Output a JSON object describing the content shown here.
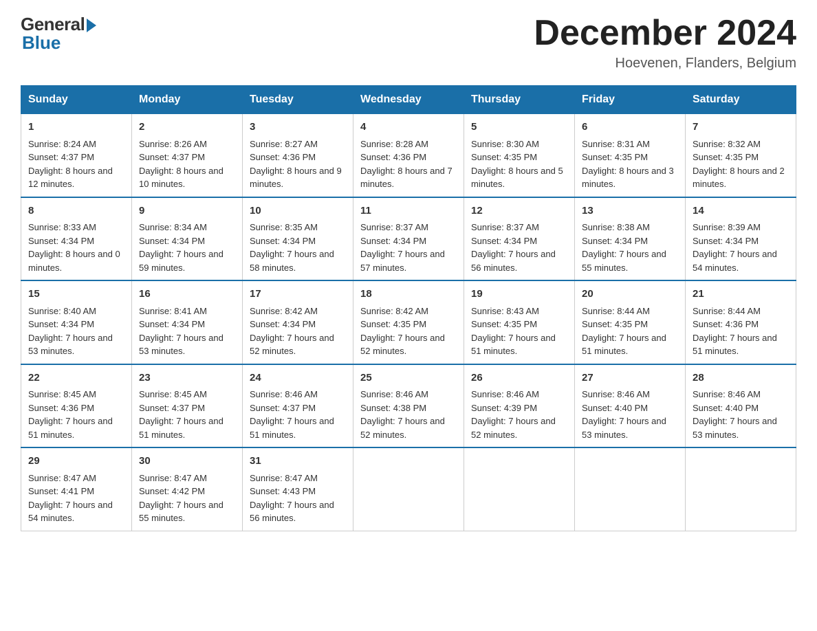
{
  "header": {
    "logo_general": "General",
    "logo_blue": "Blue",
    "month_title": "December 2024",
    "location": "Hoevenen, Flanders, Belgium"
  },
  "weekdays": [
    "Sunday",
    "Monday",
    "Tuesday",
    "Wednesday",
    "Thursday",
    "Friday",
    "Saturday"
  ],
  "weeks": [
    [
      {
        "day": "1",
        "sunrise": "8:24 AM",
        "sunset": "4:37 PM",
        "daylight": "8 hours and 12 minutes."
      },
      {
        "day": "2",
        "sunrise": "8:26 AM",
        "sunset": "4:37 PM",
        "daylight": "8 hours and 10 minutes."
      },
      {
        "day": "3",
        "sunrise": "8:27 AM",
        "sunset": "4:36 PM",
        "daylight": "8 hours and 9 minutes."
      },
      {
        "day": "4",
        "sunrise": "8:28 AM",
        "sunset": "4:36 PM",
        "daylight": "8 hours and 7 minutes."
      },
      {
        "day": "5",
        "sunrise": "8:30 AM",
        "sunset": "4:35 PM",
        "daylight": "8 hours and 5 minutes."
      },
      {
        "day": "6",
        "sunrise": "8:31 AM",
        "sunset": "4:35 PM",
        "daylight": "8 hours and 3 minutes."
      },
      {
        "day": "7",
        "sunrise": "8:32 AM",
        "sunset": "4:35 PM",
        "daylight": "8 hours and 2 minutes."
      }
    ],
    [
      {
        "day": "8",
        "sunrise": "8:33 AM",
        "sunset": "4:34 PM",
        "daylight": "8 hours and 0 minutes."
      },
      {
        "day": "9",
        "sunrise": "8:34 AM",
        "sunset": "4:34 PM",
        "daylight": "7 hours and 59 minutes."
      },
      {
        "day": "10",
        "sunrise": "8:35 AM",
        "sunset": "4:34 PM",
        "daylight": "7 hours and 58 minutes."
      },
      {
        "day": "11",
        "sunrise": "8:37 AM",
        "sunset": "4:34 PM",
        "daylight": "7 hours and 57 minutes."
      },
      {
        "day": "12",
        "sunrise": "8:37 AM",
        "sunset": "4:34 PM",
        "daylight": "7 hours and 56 minutes."
      },
      {
        "day": "13",
        "sunrise": "8:38 AM",
        "sunset": "4:34 PM",
        "daylight": "7 hours and 55 minutes."
      },
      {
        "day": "14",
        "sunrise": "8:39 AM",
        "sunset": "4:34 PM",
        "daylight": "7 hours and 54 minutes."
      }
    ],
    [
      {
        "day": "15",
        "sunrise": "8:40 AM",
        "sunset": "4:34 PM",
        "daylight": "7 hours and 53 minutes."
      },
      {
        "day": "16",
        "sunrise": "8:41 AM",
        "sunset": "4:34 PM",
        "daylight": "7 hours and 53 minutes."
      },
      {
        "day": "17",
        "sunrise": "8:42 AM",
        "sunset": "4:34 PM",
        "daylight": "7 hours and 52 minutes."
      },
      {
        "day": "18",
        "sunrise": "8:42 AM",
        "sunset": "4:35 PM",
        "daylight": "7 hours and 52 minutes."
      },
      {
        "day": "19",
        "sunrise": "8:43 AM",
        "sunset": "4:35 PM",
        "daylight": "7 hours and 51 minutes."
      },
      {
        "day": "20",
        "sunrise": "8:44 AM",
        "sunset": "4:35 PM",
        "daylight": "7 hours and 51 minutes."
      },
      {
        "day": "21",
        "sunrise": "8:44 AM",
        "sunset": "4:36 PM",
        "daylight": "7 hours and 51 minutes."
      }
    ],
    [
      {
        "day": "22",
        "sunrise": "8:45 AM",
        "sunset": "4:36 PM",
        "daylight": "7 hours and 51 minutes."
      },
      {
        "day": "23",
        "sunrise": "8:45 AM",
        "sunset": "4:37 PM",
        "daylight": "7 hours and 51 minutes."
      },
      {
        "day": "24",
        "sunrise": "8:46 AM",
        "sunset": "4:37 PM",
        "daylight": "7 hours and 51 minutes."
      },
      {
        "day": "25",
        "sunrise": "8:46 AM",
        "sunset": "4:38 PM",
        "daylight": "7 hours and 52 minutes."
      },
      {
        "day": "26",
        "sunrise": "8:46 AM",
        "sunset": "4:39 PM",
        "daylight": "7 hours and 52 minutes."
      },
      {
        "day": "27",
        "sunrise": "8:46 AM",
        "sunset": "4:40 PM",
        "daylight": "7 hours and 53 minutes."
      },
      {
        "day": "28",
        "sunrise": "8:46 AM",
        "sunset": "4:40 PM",
        "daylight": "7 hours and 53 minutes."
      }
    ],
    [
      {
        "day": "29",
        "sunrise": "8:47 AM",
        "sunset": "4:41 PM",
        "daylight": "7 hours and 54 minutes."
      },
      {
        "day": "30",
        "sunrise": "8:47 AM",
        "sunset": "4:42 PM",
        "daylight": "7 hours and 55 minutes."
      },
      {
        "day": "31",
        "sunrise": "8:47 AM",
        "sunset": "4:43 PM",
        "daylight": "7 hours and 56 minutes."
      },
      null,
      null,
      null,
      null
    ]
  ]
}
